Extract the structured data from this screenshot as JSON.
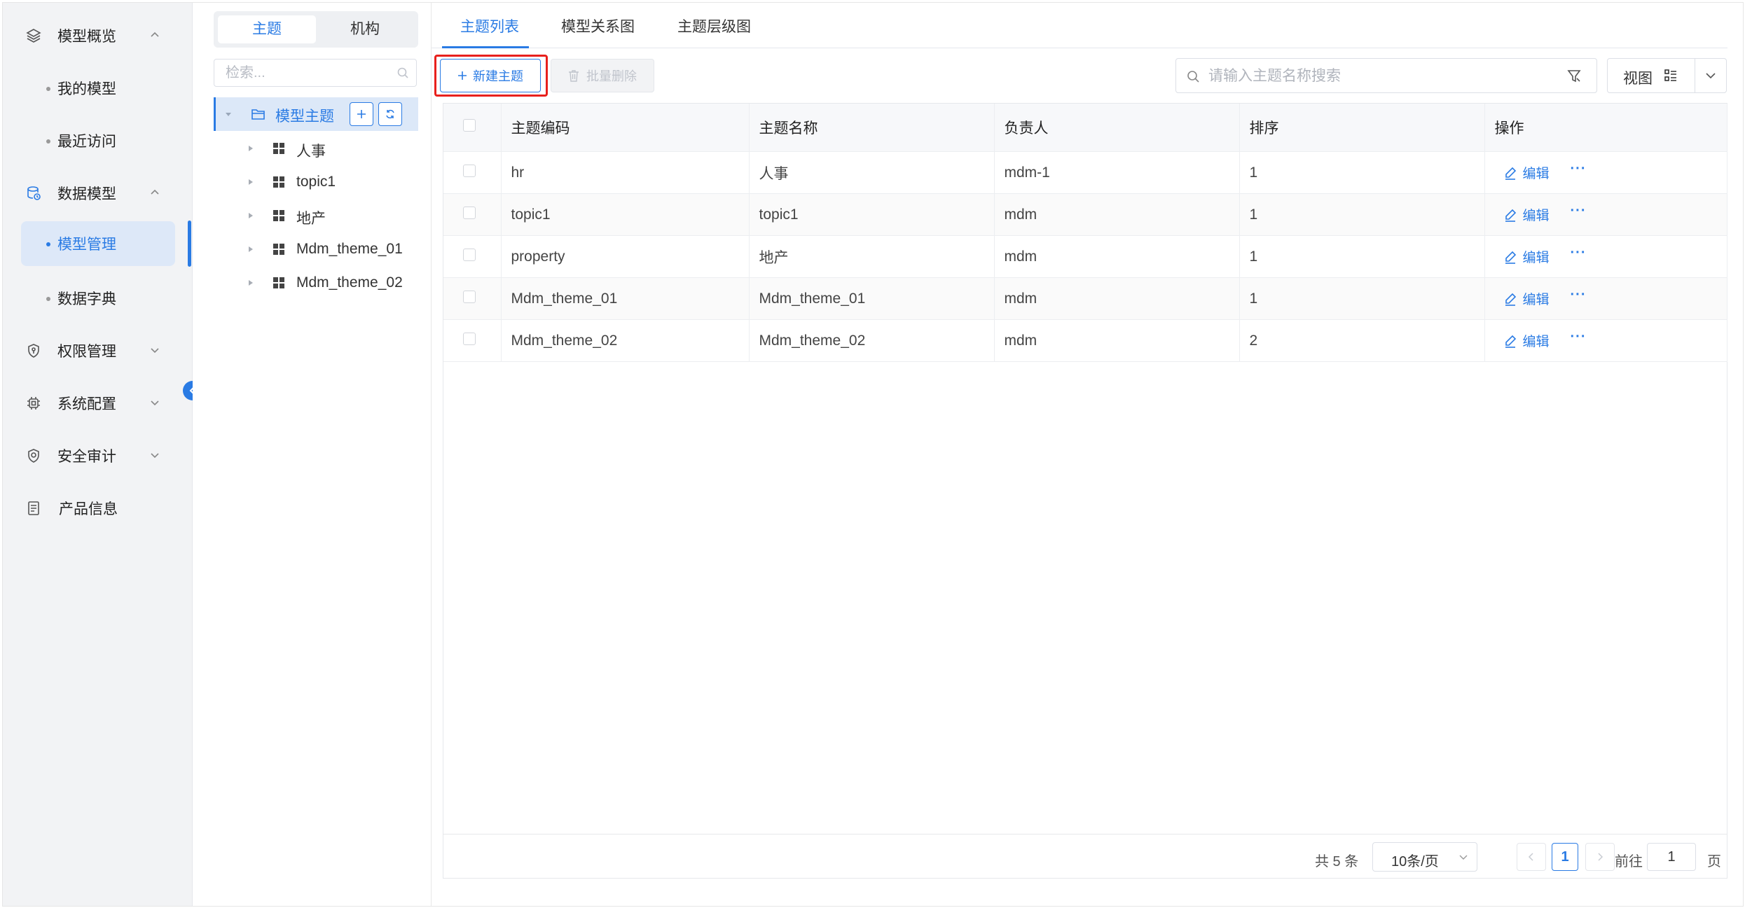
{
  "sidebar": {
    "groups": [
      {
        "label": "模型概览",
        "icon": "layers-icon",
        "expanded": true
      },
      {
        "label": "数据模型",
        "icon": "database-icon",
        "expanded": true
      },
      {
        "label": "权限管理",
        "icon": "shield-key-icon",
        "expanded": false
      },
      {
        "label": "系统配置",
        "icon": "cpu-icon",
        "expanded": false
      },
      {
        "label": "安全审计",
        "icon": "shield-check-icon",
        "expanded": false
      },
      {
        "label": "产品信息",
        "icon": "document-icon",
        "expanded": false
      }
    ],
    "sub_items": [
      {
        "label": "我的模型"
      },
      {
        "label": "最近访问"
      },
      {
        "label": "模型管理",
        "active": true
      },
      {
        "label": "数据字典"
      }
    ]
  },
  "tree": {
    "segments": [
      "主题",
      "机构"
    ],
    "search_placeholder": "检索...",
    "root_label": "模型主题",
    "nodes": [
      "人事",
      "topic1",
      "地产",
      "Mdm_theme_01",
      "Mdm_theme_02"
    ]
  },
  "tabs": [
    "主题列表",
    "模型关系图",
    "主题层级图"
  ],
  "toolbar": {
    "new_label": "新建主题",
    "batch_delete_label": "批量删除",
    "search_placeholder": "请输入主题名称搜索",
    "view_label": "视图"
  },
  "table": {
    "columns": [
      "主题编码",
      "主题名称",
      "负责人",
      "排序",
      "操作"
    ],
    "rows": [
      {
        "code": "hr",
        "name": "人事",
        "owner": "mdm-1",
        "order": "1"
      },
      {
        "code": "topic1",
        "name": "topic1",
        "owner": "mdm",
        "order": "1"
      },
      {
        "code": "property",
        "name": "地产",
        "owner": "mdm",
        "order": "1"
      },
      {
        "code": "Mdm_theme_01",
        "name": "Mdm_theme_01",
        "owner": "mdm",
        "order": "1"
      },
      {
        "code": "Mdm_theme_02",
        "name": "Mdm_theme_02",
        "owner": "mdm",
        "order": "2"
      }
    ],
    "edit_label": "编辑",
    "more_label": "···"
  },
  "pagination": {
    "total": "共 5 条",
    "page_size": "10条/页",
    "current_page": "1",
    "goto_label": "前往",
    "goto_value": "1",
    "page_unit": "页"
  },
  "colors": {
    "accent": "#2a7be4",
    "highlight": "#e8201c",
    "sidebar_bg": "#f2f3f5"
  }
}
